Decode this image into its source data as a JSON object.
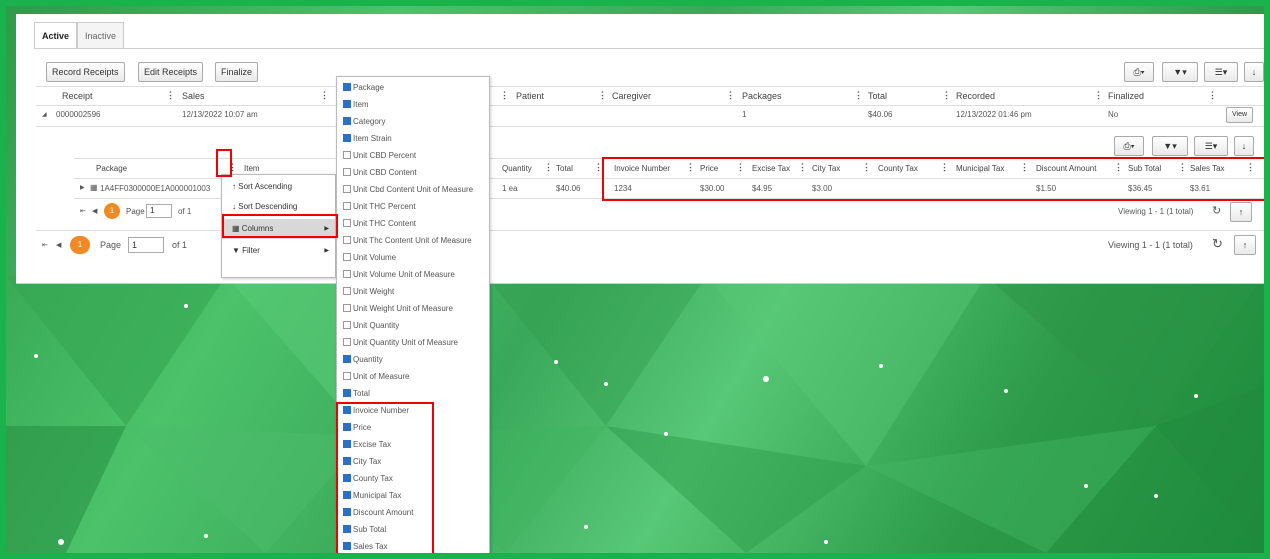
{
  "tabs": [
    "Active",
    "Inactive"
  ],
  "toolbar": {
    "record": "Record Receipts",
    "edit": "Edit Receipts",
    "finalize": "Finalize"
  },
  "icons": {
    "print": "printer-icon",
    "filter": "filter-icon",
    "columns": "list-icon",
    "download": "download-icon",
    "refresh": "refresh-icon",
    "upload": "upload-icon"
  },
  "main_headers": [
    "Receipt",
    "Sales",
    "Patient",
    "Caregiver",
    "Packages",
    "Total",
    "Recorded",
    "Finalized"
  ],
  "main_row": {
    "receipt": "0000002596",
    "sales": "12/13/2022 10:07 am",
    "packages": "1",
    "total": "$40.06",
    "recorded": "12/13/2022 01:46 pm",
    "finalized": "No",
    "view": "View"
  },
  "sub_headers_left": [
    "Package",
    "Item"
  ],
  "sub_headers_right": [
    "Quantity",
    "Total",
    "Invoice Number",
    "Price",
    "Excise Tax",
    "City Tax",
    "County Tax",
    "Municipal Tax",
    "Discount Amount",
    "Sub Total",
    "Sales Tax"
  ],
  "sub_row": {
    "package": "1A4FF0300000E1A000001003",
    "quantity": "1 ea",
    "total": "$40.06",
    "invoice": "1234",
    "price": "$30.00",
    "excise": "$4.95",
    "city": "$3.00",
    "county": "",
    "municipal": "",
    "discount": "$1.50",
    "subtotal": "$36.45",
    "salestax": "$3.61"
  },
  "pager": {
    "page_label": "Page",
    "page": "1",
    "of": "of 1",
    "viewing": "Viewing 1 - 1 (1 total)",
    "badge": "1"
  },
  "context_menu": [
    "Sort Ascending",
    "Sort Descending",
    "Columns",
    "Filter"
  ],
  "columns": [
    {
      "label": "Package",
      "checked": true
    },
    {
      "label": "Item",
      "checked": true
    },
    {
      "label": "Category",
      "checked": true
    },
    {
      "label": "Item Strain",
      "checked": true
    },
    {
      "label": "Unit CBD Percent",
      "checked": false
    },
    {
      "label": "Unit CBD Content",
      "checked": false
    },
    {
      "label": "Unit Cbd Content Unit of Measure",
      "checked": false
    },
    {
      "label": "Unit THC Percent",
      "checked": false
    },
    {
      "label": "Unit THC Content",
      "checked": false
    },
    {
      "label": "Unit Thc Content Unit of Measure",
      "checked": false
    },
    {
      "label": "Unit Volume",
      "checked": false
    },
    {
      "label": "Unit Volume Unit of Measure",
      "checked": false
    },
    {
      "label": "Unit Weight",
      "checked": false
    },
    {
      "label": "Unit Weight Unit of Measure",
      "checked": false
    },
    {
      "label": "Unit Quantity",
      "checked": false
    },
    {
      "label": "Unit Quantity Unit of Measure",
      "checked": false
    },
    {
      "label": "Quantity",
      "checked": true
    },
    {
      "label": "Unit of Measure",
      "checked": false
    },
    {
      "label": "Total",
      "checked": true
    },
    {
      "label": "Invoice Number",
      "checked": true
    },
    {
      "label": "Price",
      "checked": true
    },
    {
      "label": "Excise Tax",
      "checked": true
    },
    {
      "label": "City Tax",
      "checked": true
    },
    {
      "label": "County Tax",
      "checked": true
    },
    {
      "label": "Municipal Tax",
      "checked": true
    },
    {
      "label": "Discount Amount",
      "checked": true
    },
    {
      "label": "Sub Total",
      "checked": true
    },
    {
      "label": "Sales Tax",
      "checked": true
    }
  ],
  "colors": {
    "frame": "#19b24b",
    "highlight": "#e00000",
    "badge": "#f08a24",
    "checkbox": "#2a6fc9"
  }
}
